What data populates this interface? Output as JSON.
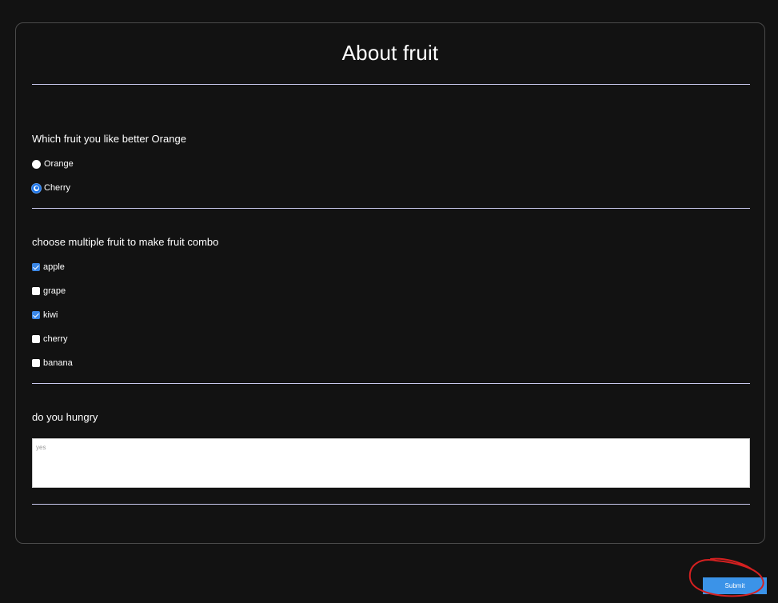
{
  "form": {
    "title": "About fruit",
    "sections": [
      {
        "question": "Which fruit you like better Orange",
        "type": "radio",
        "options": [
          {
            "label": "Orange",
            "checked": false
          },
          {
            "label": "Cherry",
            "checked": true
          }
        ]
      },
      {
        "question": "choose multiple fruit to make fruit combo",
        "type": "checkbox",
        "options": [
          {
            "label": "apple",
            "checked": true
          },
          {
            "label": "grape",
            "checked": false
          },
          {
            "label": "kiwi",
            "checked": true
          },
          {
            "label": "cherry",
            "checked": false
          },
          {
            "label": "banana",
            "checked": false
          }
        ]
      },
      {
        "question": "do you hungry",
        "type": "textarea",
        "placeholder": "yes"
      }
    ],
    "submit_label": "Submit"
  },
  "colors": {
    "background": "#121212",
    "accent": "#3b93e8",
    "divider": "#c9c9ee",
    "annotation": "#d42020"
  }
}
